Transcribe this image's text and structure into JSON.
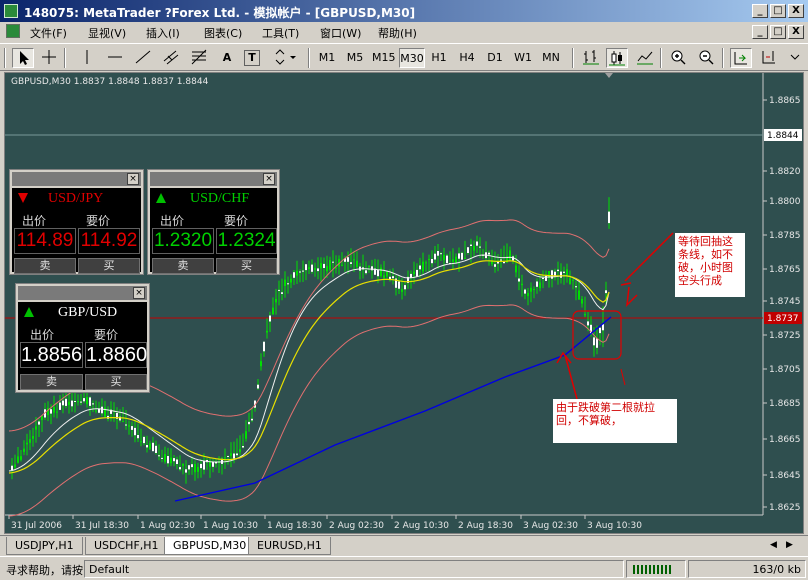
{
  "window": {
    "title": "148075: MetaTrader ?Forex Ltd. - 模拟帐户 - [GBPUSD,M30]",
    "controls": [
      "_",
      "□",
      "X"
    ]
  },
  "menu": {
    "items": [
      "文件(F)",
      "显视(V)",
      "插入(I)",
      "图表(C)",
      "工具(T)",
      "窗口(W)",
      "帮助(H)"
    ],
    "mdi_controls": [
      "_",
      "□",
      "X"
    ]
  },
  "toolbar": {
    "text_tool": "A",
    "label_tool": "T",
    "timeframes": [
      "M1",
      "M5",
      "M15",
      "M30",
      "H1",
      "H4",
      "D1",
      "W1",
      "MN"
    ],
    "active_timeframe": "M30"
  },
  "chart": {
    "info": "GBPUSD,M30  1.8837 1.8848 1.8837 1.8844",
    "price_labels": [
      "1.8865",
      "1.8844",
      "1.8820",
      "1.8800",
      "1.8785",
      "1.8765",
      "1.8745",
      "1.8725",
      "1.8705",
      "1.8685",
      "1.8665",
      "1.8645",
      "1.8625"
    ],
    "current_price": "1.8844",
    "hline_price_label": "1.8737",
    "time_labels": [
      "31 Jul 2006",
      "31 Jul 18:30",
      "1 Aug 02:30",
      "1 Aug 10:30",
      "1 Aug 18:30",
      "2 Aug 02:30",
      "2 Aug 10:30",
      "2 Aug 18:30",
      "3 Aug 02:30",
      "3 Aug 10:30"
    ],
    "colors": {
      "background": "#2f4f4f",
      "candles": "#00e000",
      "ma_white": "#f0f0f0",
      "ma_yellow": "#e8e000",
      "ma_blue": "#0000e0",
      "bands": "#e07070",
      "hline": "#c00000",
      "annotation": "#e00000"
    }
  },
  "terminals": [
    {
      "symbol": "USD/JPY",
      "direction": "down",
      "sell_label": "出价",
      "buy_label": "要价",
      "bid": "114.89",
      "ask": "114.92",
      "sell_btn": "卖",
      "buy_btn": "买",
      "color": "#e00000"
    },
    {
      "symbol": "USD/CHF",
      "direction": "up",
      "sell_label": "出价",
      "buy_label": "要价",
      "bid": "1.2320",
      "ask": "1.2324",
      "sell_btn": "卖",
      "buy_btn": "买",
      "color": "#00d000"
    },
    {
      "symbol": "GBP/USD",
      "direction": "up",
      "sell_label": "出价",
      "buy_label": "要价",
      "bid": "1.8856",
      "ask": "1.8860",
      "sell_btn": "卖",
      "buy_btn": "买",
      "color": "#ffffff"
    }
  ],
  "annotations": {
    "top_right": "等待回抽这\n条线，如不\n破，小时图\n空头行成",
    "bottom": "由于跌破第二根就拉\n回，不算破，"
  },
  "tabs": [
    "USDJPY,H1",
    "USDCHF,H1",
    "GBPUSD,M30",
    "EURUSD,H1"
  ],
  "active_tab": "GBPUSD,M30",
  "status": {
    "help": "寻求帮助，请按",
    "profile": "Default",
    "traffic": "163/0 kb"
  }
}
